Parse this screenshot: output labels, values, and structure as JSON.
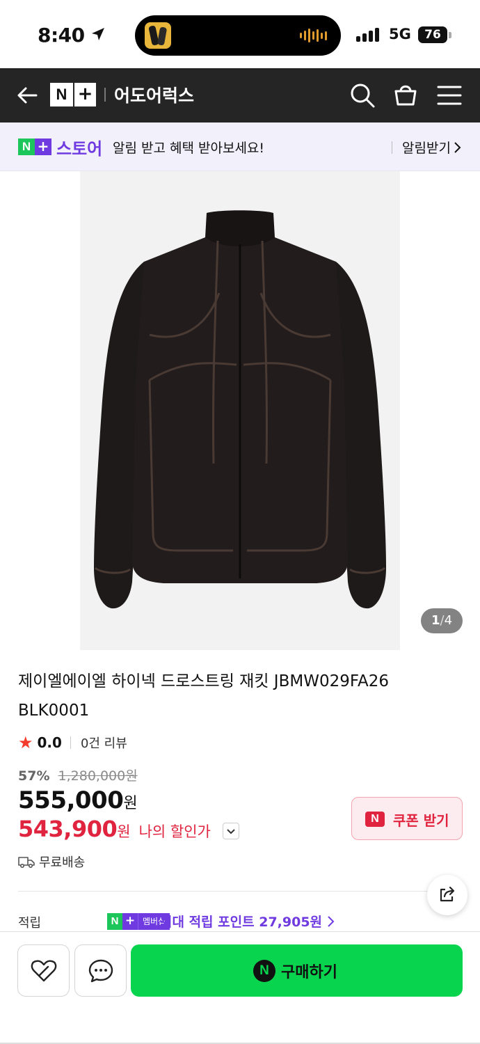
{
  "status_bar": {
    "time": "8:40",
    "network": "5G",
    "battery": "76"
  },
  "header": {
    "logo_n": "N",
    "logo_plus": "+",
    "store_name": "어도어럭스"
  },
  "notice": {
    "logo_n": "N",
    "logo_plus": "+",
    "store_label": "스토어",
    "message": "알림 받고 혜택 받아보세요!",
    "action": "알림받기"
  },
  "gallery": {
    "current": "1",
    "separator": "/",
    "total": "4"
  },
  "product": {
    "title": "제이엘에이엘 하이넥 드로스트링 재킷 JBMW029FA26 BLK0001",
    "rating": {
      "star": "★",
      "score": "0.0",
      "reviews": "0건 리뷰"
    },
    "discount_pct": "57%",
    "original_price": "1,280,000원",
    "price": "555,000",
    "price_unit": "원",
    "my_price": "543,900",
    "my_price_unit": "원",
    "my_price_label": "나의 할인가",
    "coupon_icon": "N",
    "coupon_button": "쿠폰 받기",
    "shipping": "무료배송",
    "points_label": "적립",
    "points_badge_n": "N",
    "points_badge_plus": "+",
    "points_badge_member": "멤버십",
    "points_text_prefix": "최대 적립 포인트",
    "points_value": "27,905원"
  },
  "bottom_bar": {
    "buy_icon": "N",
    "buy_label": "구매하기"
  },
  "colors": {
    "header_bg": "#252525",
    "naver_green": "#08d44e",
    "store_purple": "#6f3be0",
    "sale_red": "#e0233e"
  }
}
